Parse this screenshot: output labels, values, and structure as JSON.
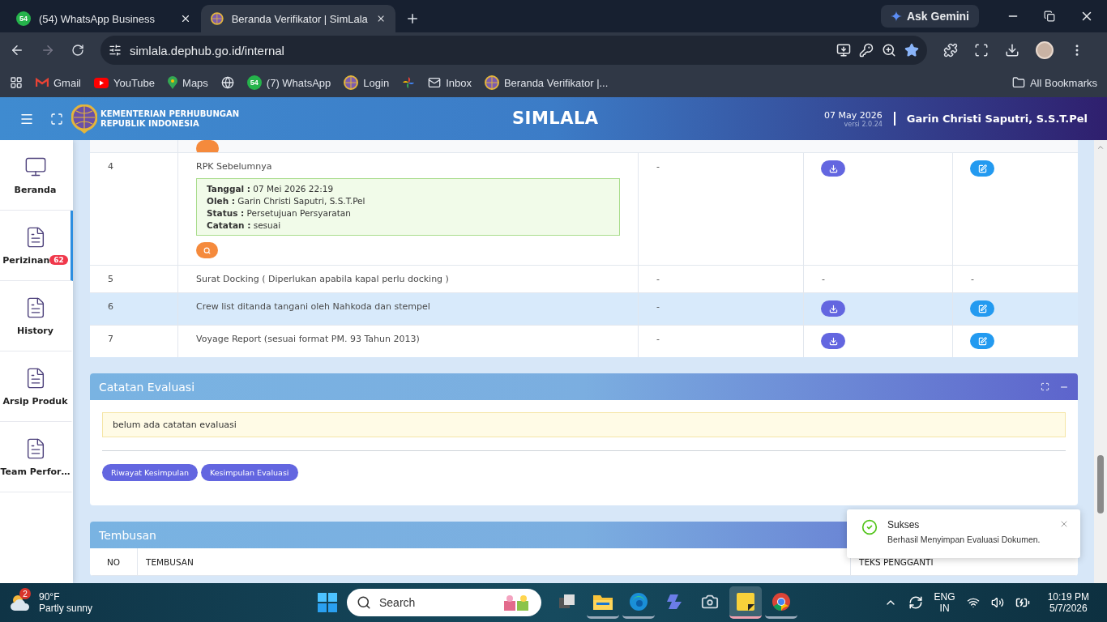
{
  "browser": {
    "tabs": [
      {
        "title": "(54) WhatsApp Business",
        "badge": "54",
        "selected": false
      },
      {
        "title": "Beranda Verifikator | SimLala",
        "selected": true
      }
    ],
    "address": "simlala.dephub.go.id/internal",
    "gemini": "Ask Gemini",
    "bookmarked": true,
    "bookmarks": [
      {
        "label": "Gmail"
      },
      {
        "label": "YouTube"
      },
      {
        "label": "Maps"
      },
      {
        "badge": "54",
        "label": "(7) WhatsApp"
      },
      {
        "label": "Login"
      },
      {
        "label": "Inbox"
      },
      {
        "label": "Beranda Verifikator |..."
      }
    ],
    "all_bookmarks": "All Bookmarks"
  },
  "header": {
    "org": [
      "KEMENTERIAN PERHUBUNGAN",
      "REPUBLIK INDONESIA"
    ],
    "title": "SIMLALA",
    "date": "07 May 2026",
    "version": "versi 2.0.24",
    "user": "Garin Christi Saputri, S.S.T.Pel"
  },
  "sidebar": {
    "items": [
      {
        "label": "Beranda",
        "selected": false
      },
      {
        "label": "Perizinan",
        "badge": "62",
        "selected": true
      },
      {
        "label": "History",
        "selected": false
      },
      {
        "label": "Arsip Produk",
        "selected": false
      },
      {
        "label": "Team Perfor…",
        "selected": false
      }
    ]
  },
  "documents": {
    "previous_row": {
      "preview": true
    },
    "rows": [
      {
        "no": "4",
        "name": "RPK Sebelumnya",
        "highlighted": false,
        "preview": true,
        "detail": [
          {
            "label": "Tanggal :",
            "value": "07 Mei 2026 22:19"
          },
          {
            "label": "Oleh :",
            "value": "Garin Christi Saputri, S.S.T.Pel"
          },
          {
            "label": "Status :",
            "value": "Persetujuan Persyaratan"
          },
          {
            "label": "Catatan :",
            "value": "sesuai"
          }
        ],
        "cells": [
          {
            "kind": "text",
            "text": "-"
          },
          {
            "kind": "download"
          },
          {
            "kind": "edit"
          }
        ]
      },
      {
        "no": "5",
        "name": "Surat Docking ( Diperlukan apabila kapal perlu docking )",
        "highlighted": false,
        "preview": false,
        "cells": [
          {
            "kind": "text",
            "text": "-"
          },
          {
            "kind": "text",
            "text": "-"
          },
          {
            "kind": "text",
            "text": "-"
          }
        ]
      },
      {
        "no": "6",
        "name": "Crew list ditanda tangani oleh Nahkoda dan stempel",
        "highlighted": true,
        "preview": false,
        "cells": [
          {
            "kind": "text",
            "text": "-"
          },
          {
            "kind": "download"
          },
          {
            "kind": "edit"
          }
        ]
      },
      {
        "no": "7",
        "name": "Voyage Report (sesuai format PM. 93 Tahun 2013)",
        "highlighted": false,
        "preview": false,
        "cells": [
          {
            "kind": "text",
            "text": "-"
          },
          {
            "kind": "download"
          },
          {
            "kind": "edit"
          }
        ]
      }
    ]
  },
  "evaluation": {
    "title": "Catatan Evaluasi",
    "note": "belum ada catatan evaluasi",
    "buttons": [
      "Riwayat Kesimpulan",
      "Kesimpulan Evaluasi"
    ]
  },
  "cc": {
    "title": "Tembusan",
    "columns": [
      "NO",
      "TEMBUSAN",
      "TEKS PENGGANTI"
    ]
  },
  "toast": {
    "title": "Sukses",
    "message": "Berhasil Menyimpan Evaluasi Dokumen."
  },
  "taskbar": {
    "weather": {
      "temp": "90°F",
      "text": "Partly sunny",
      "badge": "2"
    },
    "search": "Search",
    "apps": [
      {
        "running": false,
        "active": false
      },
      {
        "running": true,
        "active": false
      },
      {
        "running": true,
        "active": false
      },
      {
        "running": false,
        "active": false
      },
      {
        "running": false,
        "active": false
      },
      {
        "running": true,
        "active": true
      },
      {
        "running": true,
        "active": false
      }
    ],
    "lang": [
      "ENG",
      "IN"
    ],
    "time": "10:19 PM",
    "date": "5/7/2026"
  }
}
